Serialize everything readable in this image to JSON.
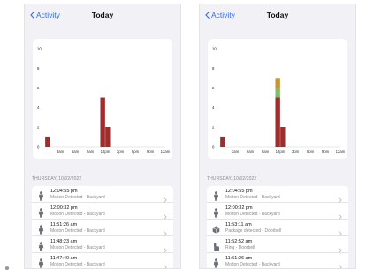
{
  "screens": [
    {
      "nav": {
        "back_label": "Activity",
        "title": "Today"
      },
      "section_header": "THURSDAY, 10/02/2022",
      "events": [
        {
          "time": "12:04:55 pm",
          "desc": "Motion Detected - Backyard",
          "icon": "person-motion-icon"
        },
        {
          "time": "12:00:32 pm",
          "desc": "Motion Detected - Backyard",
          "icon": "person-motion-icon"
        },
        {
          "time": "11:51:26 am",
          "desc": "Motion Detected - Backyard",
          "icon": "person-motion-icon"
        },
        {
          "time": "11:48:23 am",
          "desc": "Motion Detected - Backyard",
          "icon": "person-motion-icon"
        },
        {
          "time": "11:47:40 am",
          "desc": "Motion Detected - Backyard",
          "icon": "person-motion-icon"
        }
      ]
    },
    {
      "nav": {
        "back_label": "Activity",
        "title": "Today"
      },
      "section_header": "THURSDAY, 10/02/2022",
      "events": [
        {
          "time": "12:04:55 pm",
          "desc": "Motion Detected - Backyard",
          "icon": "person-motion-icon"
        },
        {
          "time": "12:00:32 pm",
          "desc": "Motion Detected - Backyard",
          "icon": "person-motion-icon"
        },
        {
          "time": "11:53:11 am",
          "desc": "Package detected - Doorbell",
          "icon": "package-icon"
        },
        {
          "time": "11:52:52 am",
          "desc": "Ring - Doorbell",
          "icon": "doorbell-ring-icon"
        },
        {
          "time": "11:51:26 am",
          "desc": "Motion Detected - Backyard",
          "icon": "person-motion-icon"
        }
      ]
    }
  ],
  "chart_data": [
    {
      "type": "bar",
      "y_ticks": [
        0,
        2,
        4,
        6,
        8,
        10
      ],
      "ylim": [
        0,
        10
      ],
      "x_ticks": [
        "3am",
        "6am",
        "9am",
        "12pm",
        "3pm",
        "6pm",
        "9pm",
        "12am"
      ],
      "colors": {
        "motion": "#a12c2c"
      },
      "series": [
        {
          "values": [
            {
              "hour": 0,
              "value": 1
            },
            {
              "hour": 11,
              "value": 5
            },
            {
              "hour": 12,
              "value": 2
            }
          ]
        }
      ]
    },
    {
      "type": "bar",
      "stacked": true,
      "y_ticks": [
        0,
        2,
        4,
        6,
        8,
        10
      ],
      "ylim": [
        0,
        10
      ],
      "x_ticks": [
        "3am",
        "6am",
        "9am",
        "12pm",
        "3pm",
        "6pm",
        "9pm",
        "12am"
      ],
      "colors": {
        "motion": "#a12c2c",
        "package": "#7fbd6a",
        "ring": "#c99433"
      },
      "series": [
        {
          "values": [
            {
              "hour": 0,
              "value": 1
            },
            {
              "hour": 11,
              "value": 5
            },
            {
              "hour": 12,
              "value": 2
            }
          ]
        },
        {
          "values": [
            {
              "hour": 11,
              "value": 1
            }
          ]
        },
        {
          "values": [
            {
              "hour": 11,
              "value": 1
            }
          ]
        }
      ]
    }
  ]
}
